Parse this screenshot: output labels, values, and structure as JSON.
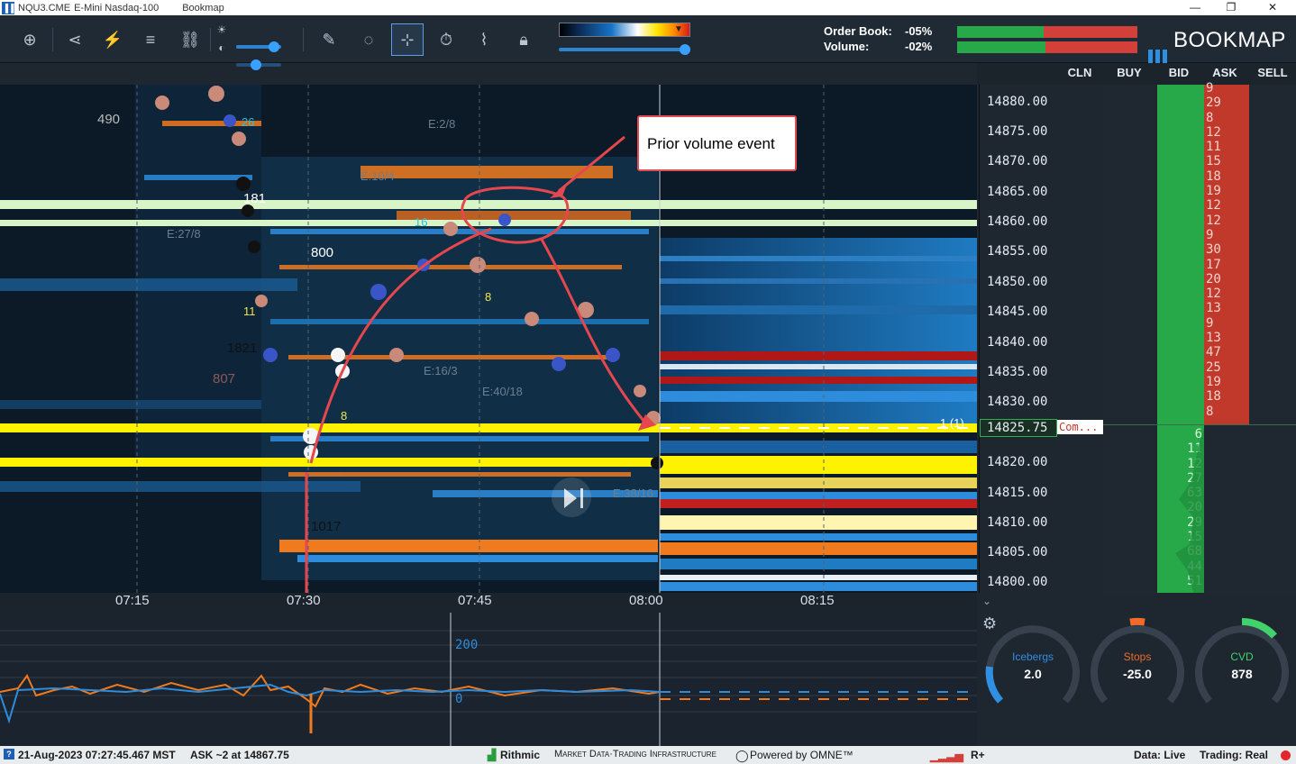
{
  "window": {
    "symbol": "NQU3.CME",
    "instrument": "E-Mini Nasdaq-100",
    "app": "Bookmap"
  },
  "toolbar": {
    "icons": [
      "zoom-fit-icon",
      "share-icon",
      "strategy-icon",
      "layers-icon",
      "link-icon",
      "brightness-icon",
      "pencil-icon",
      "chat-icon",
      "crosshair-icon",
      "timer-icon",
      "chart-line-icon",
      "lock-icon"
    ],
    "order_book_label": "Order Book:",
    "order_book_value": "-05%",
    "volume_label": "Volume:",
    "volume_value": "-02%",
    "logo_text": "BOOKMAP"
  },
  "columns": {
    "cln": "CLN",
    "buy": "BUY",
    "bid": "BID",
    "ask": "ASK",
    "sell": "SELL"
  },
  "prices": [
    "14880.00",
    "14875.00",
    "14870.00",
    "14865.00",
    "14860.00",
    "14855.00",
    "14850.00",
    "14845.00",
    "14840.00",
    "14835.00",
    "14830.00",
    "14825.75",
    "14820.00",
    "14815.00",
    "14810.00",
    "14805.00",
    "14800.00"
  ],
  "current_price_tag": "Com...",
  "position_marker": "1 (1)",
  "ask_sizes": [
    "9",
    "29",
    "8",
    "12",
    "11",
    "15",
    "18",
    "19",
    "12",
    "12",
    "9",
    "30",
    "17",
    "20",
    "12",
    "13",
    "9",
    "13",
    "47",
    "25",
    "19",
    "18",
    "8"
  ],
  "bid_sizes": [
    "6",
    "11",
    "12",
    "27",
    "63",
    "20",
    "29",
    "15",
    "68",
    "44",
    "51"
  ],
  "chart_labels": {
    "bubble_labels": [
      "490",
      "181",
      "800",
      "1821",
      "1017",
      "807"
    ],
    "small_labels": [
      "26",
      "11",
      "8",
      "8",
      "16"
    ],
    "value_labels": [
      "E:2/8",
      "E:10/4",
      "E:27/8",
      "E:40/18",
      "E:16/3",
      "E:38/16"
    ]
  },
  "callout_text": "Prior volume event",
  "time_ticks": [
    "07:15",
    "07:30",
    "07:45",
    "08:00",
    "08:15"
  ],
  "indicator": {
    "level_200": "200",
    "level_0": "0"
  },
  "gauges": [
    {
      "name": "Icebergs",
      "value": "2.0",
      "color": "#2f8fe0"
    },
    {
      "name": "Stops",
      "value": "-25.0",
      "color": "#f06a2a"
    },
    {
      "name": "CVD",
      "value": "878",
      "color": "#3fd36a"
    }
  ],
  "status": {
    "datetime": "21-Aug-2023 07:27:45.467 MST",
    "ask": "ASK ~2 at 14867.75",
    "provider": "Rithmic",
    "provider_tagline": "Market Data·Trading Infrastructure",
    "powered": "Powered by OMNE™",
    "rplus": "R+",
    "data_live": "Data: Live",
    "trading_real": "Trading: Real"
  },
  "colors": {
    "ask_red": "#c0392b",
    "bid_green": "#27a94a",
    "highlight_yellow": "#fff200",
    "highlight_pale": "#d8f5c8",
    "buy_orange": "#f07a1e",
    "sell_blue": "#2e8cdc",
    "annotation_red": "#e4474d"
  }
}
